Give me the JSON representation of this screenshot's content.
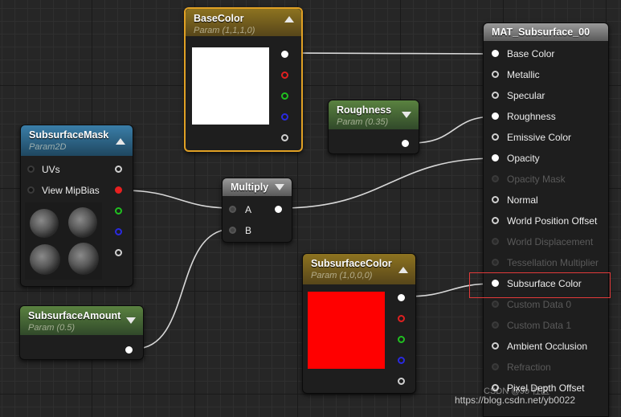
{
  "nodes": {
    "base_color": {
      "title": "BaseColor",
      "subtitle": "Param (1,1,1,0)",
      "swatch": "#ffffff"
    },
    "roughness": {
      "title": "Roughness",
      "subtitle": "Param (0.35)"
    },
    "subsurface_mask": {
      "title": "SubsurfaceMask",
      "subtitle": "Param2D",
      "inputs": [
        "UVs",
        "View MipBias"
      ]
    },
    "multiply": {
      "title": "Multiply",
      "inputs": [
        "A",
        "B"
      ]
    },
    "subsurface_amount": {
      "title": "SubsurfaceAmount",
      "subtitle": "Param (0.5)"
    },
    "subsurface_color": {
      "title": "SubsurfaceColor",
      "subtitle": "Param (1,0,0,0)",
      "swatch": "#ff0000"
    },
    "material": {
      "title": "MAT_Subsurface_00",
      "pins": [
        {
          "label": "Base Color",
          "active": true
        },
        {
          "label": "Metallic",
          "active": true
        },
        {
          "label": "Specular",
          "active": true
        },
        {
          "label": "Roughness",
          "active": true
        },
        {
          "label": "Emissive Color",
          "active": true
        },
        {
          "label": "Opacity",
          "active": true
        },
        {
          "label": "Opacity Mask",
          "active": false
        },
        {
          "label": "Normal",
          "active": true
        },
        {
          "label": "World Position Offset",
          "active": true
        },
        {
          "label": "World Displacement",
          "active": false
        },
        {
          "label": "Tessellation Multiplier",
          "active": false
        },
        {
          "label": "Subsurface Color",
          "active": true,
          "highlighted": true
        },
        {
          "label": "Custom Data 0",
          "active": false
        },
        {
          "label": "Custom Data 1",
          "active": false
        },
        {
          "label": "Ambient Occlusion",
          "active": true
        },
        {
          "label": "Refraction",
          "active": false
        },
        {
          "label": "Pixel Depth Offset",
          "active": true
        }
      ]
    }
  },
  "watermark": "https://blog.csdn.net/yb0022",
  "watermark_logo_text": "CSDN @Jo 社区",
  "colors": {
    "selection_border": "#e0a024",
    "highlight_box": "#e23a3a",
    "wire": "#d8d8d8"
  }
}
